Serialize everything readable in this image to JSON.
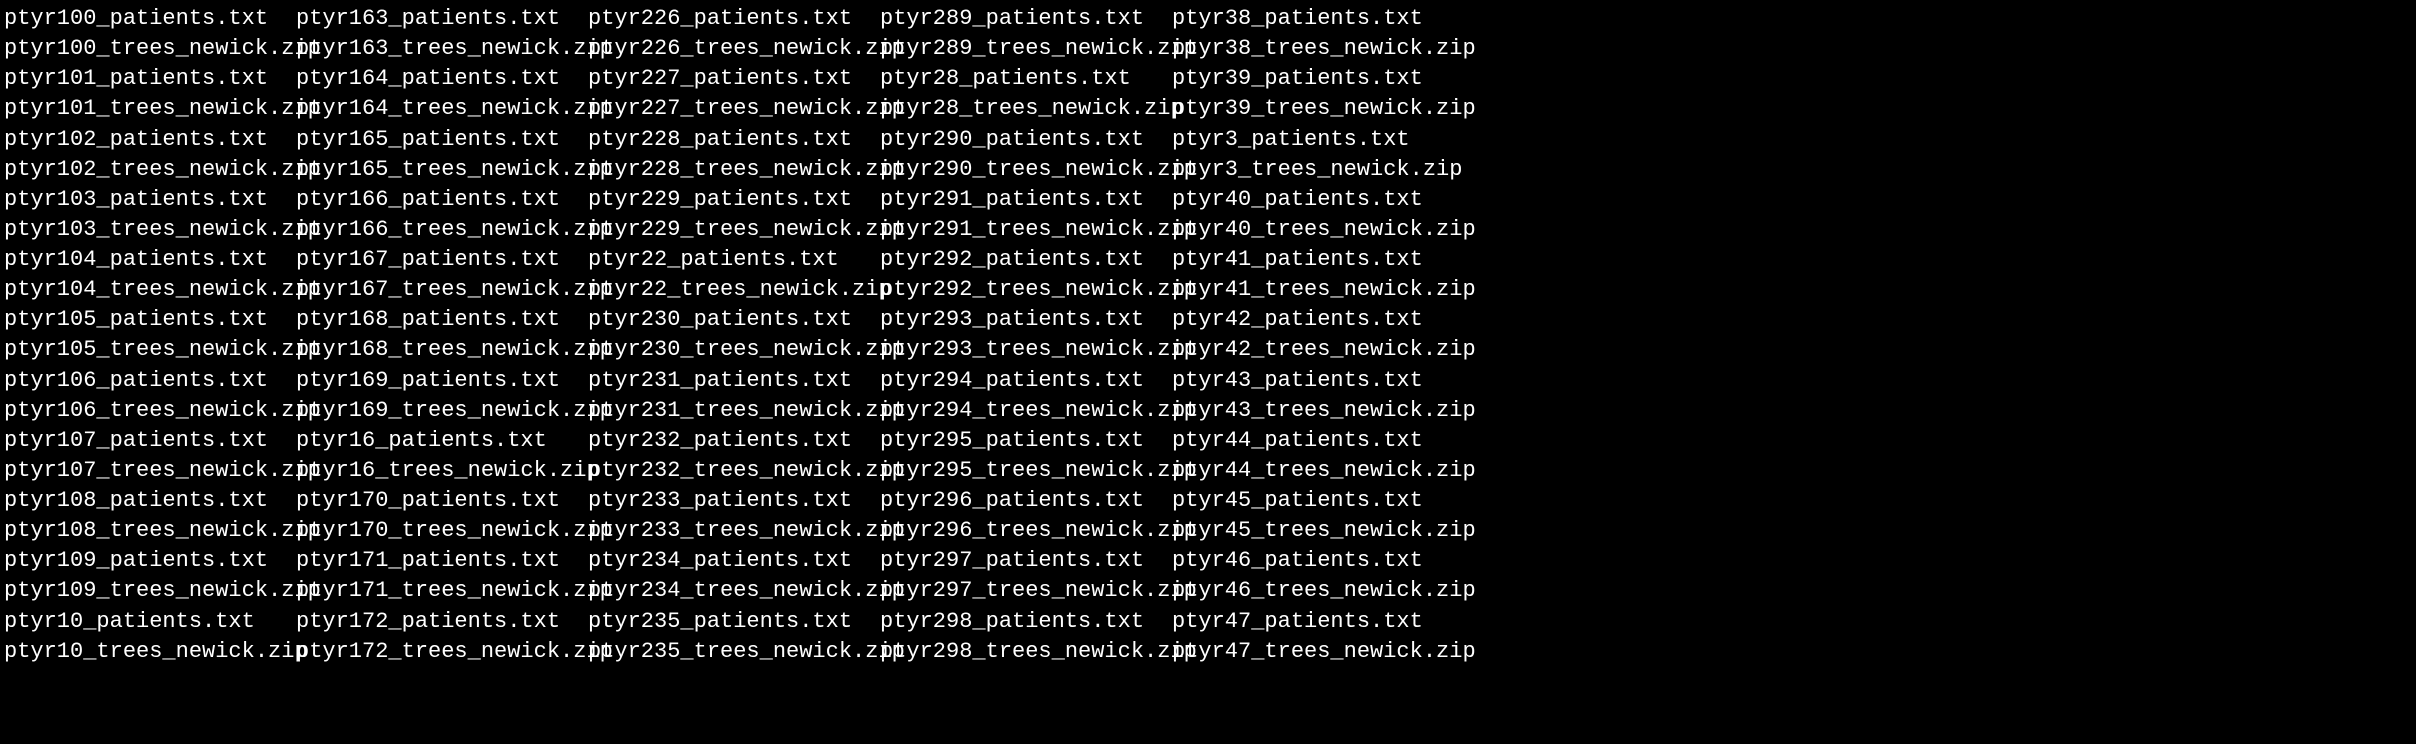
{
  "listing": {
    "columns": [
      [
        "ptyr100_patients.txt",
        "ptyr100_trees_newick.zip",
        "ptyr101_patients.txt",
        "ptyr101_trees_newick.zip",
        "ptyr102_patients.txt",
        "ptyr102_trees_newick.zip",
        "ptyr103_patients.txt",
        "ptyr103_trees_newick.zip",
        "ptyr104_patients.txt",
        "ptyr104_trees_newick.zip",
        "ptyr105_patients.txt",
        "ptyr105_trees_newick.zip",
        "ptyr106_patients.txt",
        "ptyr106_trees_newick.zip",
        "ptyr107_patients.txt",
        "ptyr107_trees_newick.zip",
        "ptyr108_patients.txt",
        "ptyr108_trees_newick.zip",
        "ptyr109_patients.txt",
        "ptyr109_trees_newick.zip",
        "ptyr10_patients.txt",
        "ptyr10_trees_newick.zip"
      ],
      [
        "ptyr163_patients.txt",
        "ptyr163_trees_newick.zip",
        "ptyr164_patients.txt",
        "ptyr164_trees_newick.zip",
        "ptyr165_patients.txt",
        "ptyr165_trees_newick.zip",
        "ptyr166_patients.txt",
        "ptyr166_trees_newick.zip",
        "ptyr167_patients.txt",
        "ptyr167_trees_newick.zip",
        "ptyr168_patients.txt",
        "ptyr168_trees_newick.zip",
        "ptyr169_patients.txt",
        "ptyr169_trees_newick.zip",
        "ptyr16_patients.txt",
        "ptyr16_trees_newick.zip",
        "ptyr170_patients.txt",
        "ptyr170_trees_newick.zip",
        "ptyr171_patients.txt",
        "ptyr171_trees_newick.zip",
        "ptyr172_patients.txt",
        "ptyr172_trees_newick.zip"
      ],
      [
        "ptyr226_patients.txt",
        "ptyr226_trees_newick.zip",
        "ptyr227_patients.txt",
        "ptyr227_trees_newick.zip",
        "ptyr228_patients.txt",
        "ptyr228_trees_newick.zip",
        "ptyr229_patients.txt",
        "ptyr229_trees_newick.zip",
        "ptyr22_patients.txt",
        "ptyr22_trees_newick.zip",
        "ptyr230_patients.txt",
        "ptyr230_trees_newick.zip",
        "ptyr231_patients.txt",
        "ptyr231_trees_newick.zip",
        "ptyr232_patients.txt",
        "ptyr232_trees_newick.zip",
        "ptyr233_patients.txt",
        "ptyr233_trees_newick.zip",
        "ptyr234_patients.txt",
        "ptyr234_trees_newick.zip",
        "ptyr235_patients.txt",
        "ptyr235_trees_newick.zip"
      ],
      [
        "ptyr289_patients.txt",
        "ptyr289_trees_newick.zip",
        "ptyr28_patients.txt",
        "ptyr28_trees_newick.zip",
        "ptyr290_patients.txt",
        "ptyr290_trees_newick.zip",
        "ptyr291_patients.txt",
        "ptyr291_trees_newick.zip",
        "ptyr292_patients.txt",
        "ptyr292_trees_newick.zip",
        "ptyr293_patients.txt",
        "ptyr293_trees_newick.zip",
        "ptyr294_patients.txt",
        "ptyr294_trees_newick.zip",
        "ptyr295_patients.txt",
        "ptyr295_trees_newick.zip",
        "ptyr296_patients.txt",
        "ptyr296_trees_newick.zip",
        "ptyr297_patients.txt",
        "ptyr297_trees_newick.zip",
        "ptyr298_patients.txt",
        "ptyr298_trees_newick.zip"
      ],
      [
        "ptyr38_patients.txt",
        "ptyr38_trees_newick.zip",
        "ptyr39_patients.txt",
        "ptyr39_trees_newick.zip",
        "ptyr3_patients.txt",
        "ptyr3_trees_newick.zip",
        "ptyr40_patients.txt",
        "ptyr40_trees_newick.zip",
        "ptyr41_patients.txt",
        "ptyr41_trees_newick.zip",
        "ptyr42_patients.txt",
        "ptyr42_trees_newick.zip",
        "ptyr43_patients.txt",
        "ptyr43_trees_newick.zip",
        "ptyr44_patients.txt",
        "ptyr44_trees_newick.zip",
        "ptyr45_patients.txt",
        "ptyr45_trees_newick.zip",
        "ptyr46_patients.txt",
        "ptyr46_trees_newick.zip",
        "ptyr47_patients.txt",
        "ptyr47_trees_newick.zip"
      ]
    ]
  }
}
